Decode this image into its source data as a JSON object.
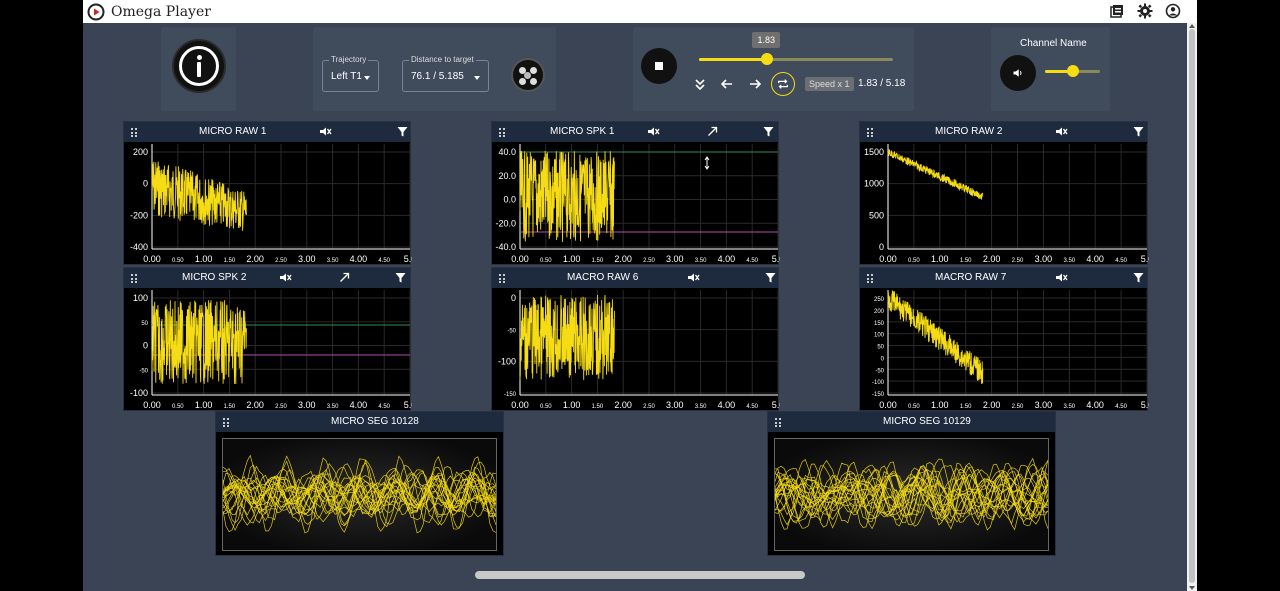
{
  "app": {
    "title": "Omega Player",
    "accent": "#f5dc14",
    "background": "#3a4454",
    "icons": [
      "omega-logo-icon",
      "layers-icon",
      "gear-icon",
      "account-icon"
    ]
  },
  "info": {
    "icon": "info-icon"
  },
  "navigation": {
    "trajectory_label": "Trajectory",
    "trajectory_value": "Left T1",
    "distance_label": "Distance to target",
    "distance_value": "76.1 / 5.185",
    "electrode_icon": "electrode-icon"
  },
  "playback": {
    "position_tip": "1.83",
    "position_fraction": 0.353,
    "speed_label": "Speed x 1",
    "time_text": "1.83 / 5.18",
    "icons": [
      "stop-icon",
      "collapse-icon",
      "arrow-left-icon",
      "arrow-right-icon",
      "loop-icon"
    ]
  },
  "channel": {
    "name": "Channel Name",
    "volume_fraction": 0.5,
    "icon": "volume-icon"
  },
  "charts": [
    {
      "title": "MICRO RAW 1",
      "y_ticks": [
        "200",
        "0",
        "-200",
        "-400"
      ],
      "x_ticks": [
        "0.00",
        "0.50",
        "1.00",
        "1.50",
        "2.00",
        "2.50",
        "3.00",
        "3.50",
        "4.00",
        "4.50",
        "5.0"
      ],
      "icons": [
        "mute-icon",
        "filter-icon"
      ]
    },
    {
      "title": "MICRO SPK 1",
      "y_ticks": [
        "40.0",
        "20.0",
        "0.0",
        "-20.0",
        "-40.0"
      ],
      "x_ticks": [
        "0.00",
        "0.50",
        "1.00",
        "1.50",
        "2.00",
        "2.50",
        "3.00",
        "3.50",
        "4.00",
        "4.50",
        "5.0"
      ],
      "icons": [
        "mute-icon",
        "threshold-icon",
        "filter-icon"
      ]
    },
    {
      "title": "MICRO RAW 2",
      "y_ticks": [
        "1500",
        "1000",
        "500",
        "0"
      ],
      "x_ticks": [
        "0.00",
        "0.50",
        "1.00",
        "1.50",
        "2.00",
        "2.50",
        "3.00",
        "3.50",
        "4.00",
        "4.50",
        "5.0"
      ],
      "icons": [
        "mute-icon",
        "filter-icon"
      ]
    },
    {
      "title": "MICRO SPK 2",
      "y_ticks": [
        "100",
        "50",
        "0",
        "-50",
        "-100"
      ],
      "x_ticks": [
        "0.00",
        "0.50",
        "1.00",
        "1.50",
        "2.00",
        "2.50",
        "3.00",
        "3.50",
        "4.00",
        "4.50",
        "5.0"
      ],
      "icons": [
        "mute-icon",
        "threshold-icon",
        "filter-icon"
      ]
    },
    {
      "title": "MACRO RAW 6",
      "y_ticks": [
        "0",
        "-50",
        "-100",
        "-150"
      ],
      "x_ticks": [
        "0.00",
        "0.50",
        "1.00",
        "1.50",
        "2.00",
        "2.50",
        "3.00",
        "3.50",
        "4.00",
        "4.50",
        "5.0"
      ],
      "icons": [
        "mute-icon",
        "filter-icon"
      ]
    },
    {
      "title": "MACRO RAW 7",
      "y_ticks": [
        "250",
        "200",
        "150",
        "100",
        "50",
        "0",
        "-50",
        "-100",
        "-150"
      ],
      "x_ticks": [
        "0.00",
        "0.50",
        "1.00",
        "1.50",
        "2.00",
        "2.50",
        "3.00",
        "3.50",
        "4.00",
        "4.50",
        "5.0"
      ],
      "icons": [
        "mute-icon",
        "filter-icon"
      ]
    }
  ],
  "segments": [
    {
      "title": "MICRO SEG 10128"
    },
    {
      "title": "MICRO SEG 10129"
    }
  ]
}
